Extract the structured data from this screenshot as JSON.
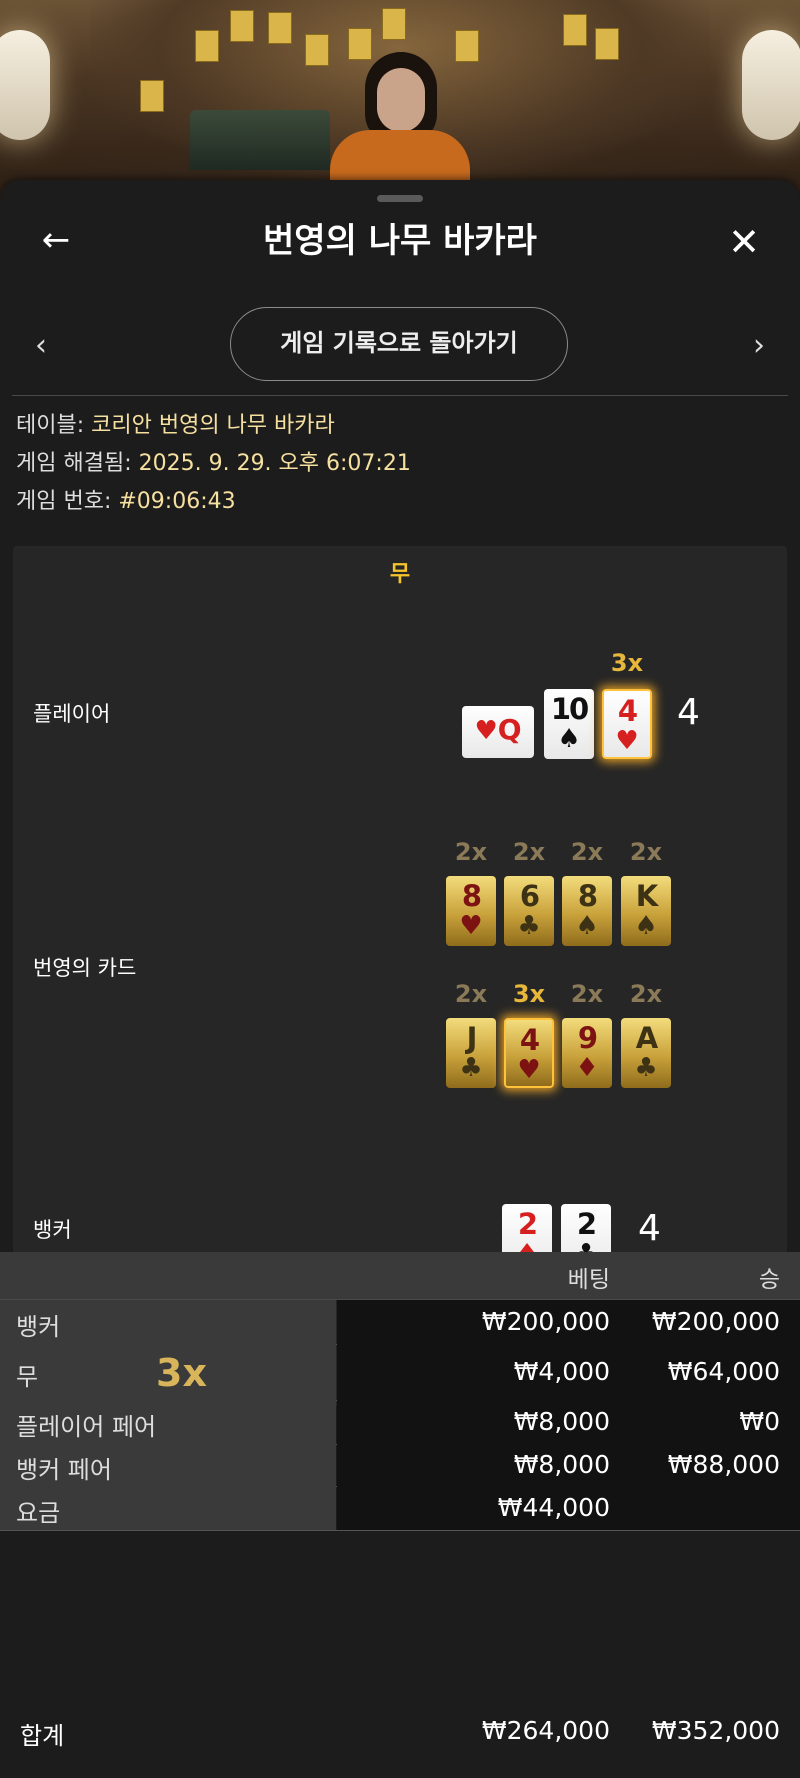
{
  "header": {
    "title": "번영의 나무 바카라",
    "back_icon": "←",
    "close_icon": "✕",
    "prev_icon": "‹",
    "next_icon": "›",
    "history_button": "게임 기록으로 돌아가기"
  },
  "info": {
    "table_label": "테이블:",
    "table_value": "코리안 번영의 나무 바카라",
    "resolved_label": "게임 해결됨:",
    "resolved_value": "2025. 9. 29. 오후 6:07:21",
    "number_label": "게임 번호:",
    "number_value": "#09:06:43"
  },
  "result": {
    "outcome": "무",
    "player_label": "플레이어",
    "player_total": "4",
    "player_cards": [
      {
        "rank": "Q",
        "suit": "♥",
        "color": "red",
        "sideways": true,
        "mult": ""
      },
      {
        "rank": "10",
        "suit": "♠",
        "color": "black",
        "mult": ""
      },
      {
        "rank": "4",
        "suit": "♥",
        "color": "red",
        "mult": "3x",
        "glow": true
      }
    ],
    "prosperity_label": "번영의 카드",
    "prosperity_row1": [
      {
        "rank": "8",
        "suit": "♥",
        "color": "red",
        "mult": "2x"
      },
      {
        "rank": "6",
        "suit": "♣",
        "color": "black",
        "mult": "2x"
      },
      {
        "rank": "8",
        "suit": "♠",
        "color": "black",
        "mult": "2x"
      },
      {
        "rank": "K",
        "suit": "♠",
        "color": "black",
        "mult": "2x"
      }
    ],
    "prosperity_row2": [
      {
        "rank": "J",
        "suit": "♣",
        "color": "black",
        "mult": "2x"
      },
      {
        "rank": "4",
        "suit": "♥",
        "color": "red",
        "mult": "3x",
        "glow": true
      },
      {
        "rank": "9",
        "suit": "♦",
        "color": "red",
        "mult": "2x"
      },
      {
        "rank": "A",
        "suit": "♣",
        "color": "black",
        "mult": "2x"
      }
    ],
    "banker_label": "뱅커",
    "banker_total": "4",
    "banker_cards": [
      {
        "rank": "2",
        "suit": "♦",
        "color": "red"
      },
      {
        "rank": "2",
        "suit": "♣",
        "color": "black"
      }
    ]
  },
  "bets": {
    "col_bet": "베팅",
    "col_win": "승",
    "rows": [
      {
        "label": "뱅커",
        "bet": "₩200,000",
        "win": "₩200,000",
        "mult": ""
      },
      {
        "label": "무",
        "bet": "₩4,000",
        "win": "₩64,000",
        "mult": "3x"
      },
      {
        "label": "플레이어 페어",
        "bet": "₩8,000",
        "win": "₩0",
        "mult": ""
      },
      {
        "label": "뱅커 페어",
        "bet": "₩8,000",
        "win": "₩88,000",
        "mult": ""
      },
      {
        "label": "요금",
        "bet": "₩44,000",
        "win": "",
        "mult": ""
      }
    ],
    "total_label": "합계",
    "total_bet": "₩264,000",
    "total_win": "₩352,000"
  }
}
